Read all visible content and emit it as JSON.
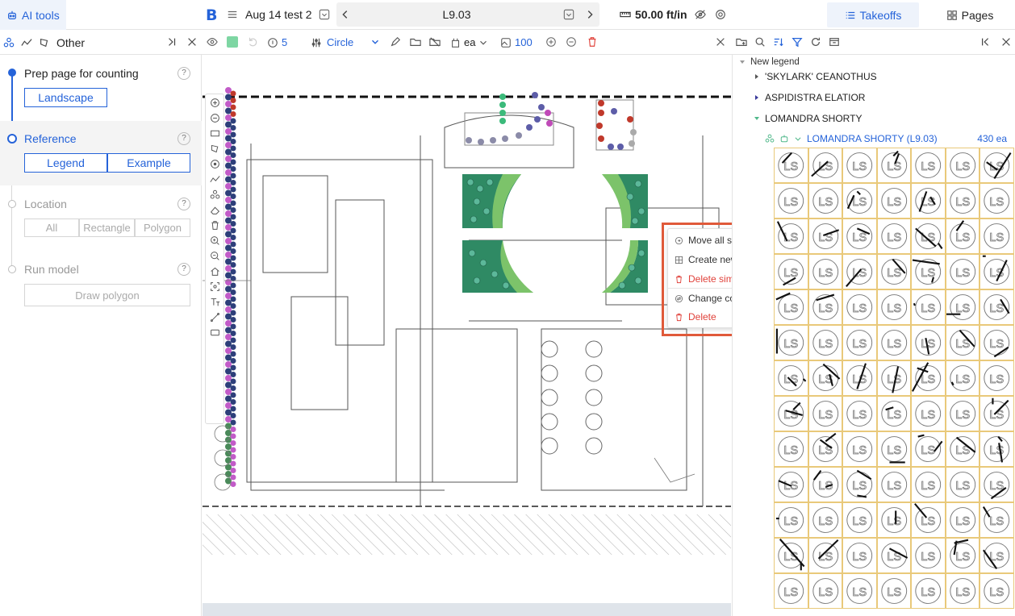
{
  "topbar": {
    "ai_tools_label": "AI tools",
    "doc_title": "Aug 14 test 2",
    "page_name": "L9.03",
    "scale": "50.00 ft/in",
    "tab_takeoffs": "Takeoffs",
    "tab_pages": "Pages"
  },
  "left_toolbar": {
    "mode_label": "Other"
  },
  "toolbar": {
    "count_value": "5",
    "shape_label": "Circle",
    "unit_label": "ea",
    "zoom_value": "100",
    "swatch_color": "#7ed6a3"
  },
  "steps": [
    {
      "title": "Prep page for counting",
      "help": "?",
      "buttons": [
        "Landscape"
      ],
      "state": "done"
    },
    {
      "title": "Reference",
      "help": "?",
      "buttons": [
        "Legend",
        "Example"
      ],
      "state": "active"
    },
    {
      "title": "Location",
      "help": "?",
      "buttons": [
        "All",
        "Rectangle",
        "Polygon"
      ],
      "state": "disabled"
    },
    {
      "title": "Run model",
      "help": "?",
      "buttons": [
        "Draw polygon"
      ],
      "state": "disabled"
    }
  ],
  "context_menu": {
    "items": [
      {
        "label": "Move all similar dots",
        "icon": "move-icon",
        "submenu": true,
        "danger": false
      },
      {
        "label": "Create new count",
        "icon": "grid-icon",
        "submenu": false,
        "danger": false
      },
      {
        "label": "Delete similar dots",
        "icon": "trash-icon",
        "submenu": false,
        "danger": true
      },
      {
        "label": "Change count",
        "icon": "swap-icon",
        "submenu": true,
        "danger": false
      },
      {
        "label": "Delete",
        "icon": "trash-icon",
        "submenu": false,
        "danger": true
      }
    ]
  },
  "takeoffs": {
    "legend_group": "New legend",
    "items": [
      {
        "label": "'SKYLARK' CEANOTHUS",
        "expanded": false,
        "color": "#555555"
      },
      {
        "label": "ASPIDISTRA ELATIOR",
        "expanded": false,
        "color": "#3a3a9a"
      },
      {
        "label": "LOMANDRA SHORTY",
        "expanded": true,
        "color": "#4fb88a"
      }
    ],
    "sub_item": {
      "label": "LOMANDRA SHORTY (L9.03)",
      "count": "430 ea"
    },
    "cell_text": "LS"
  },
  "colors": {
    "accent": "#2563d9",
    "danger": "#e0413a",
    "highlight": "#e05a3a",
    "cell_border": "#e9c97a"
  }
}
